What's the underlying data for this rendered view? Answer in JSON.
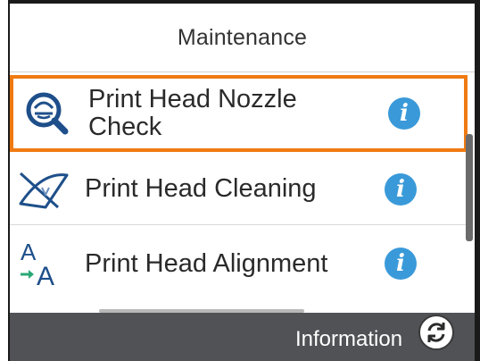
{
  "header": {
    "title": "Maintenance"
  },
  "menu": {
    "items": [
      {
        "label": "Print Head Nozzle Check",
        "icon": "nozzle-check-icon",
        "info_icon": "info-icon",
        "selected": true
      },
      {
        "label": "Print Head Cleaning",
        "icon": "head-cleaning-icon",
        "info_icon": "info-icon",
        "selected": false
      },
      {
        "label": "Print Head Alignment",
        "icon": "head-alignment-icon",
        "info_icon": "info-icon",
        "selected": false
      }
    ]
  },
  "footer": {
    "label": "Information",
    "refresh_icon": "refresh-icon"
  },
  "colors": {
    "selection_border": "#f07a12",
    "info_button": "#3a9ad9",
    "footer_background": "#505256",
    "alignment_arrow": "#2aa876"
  }
}
